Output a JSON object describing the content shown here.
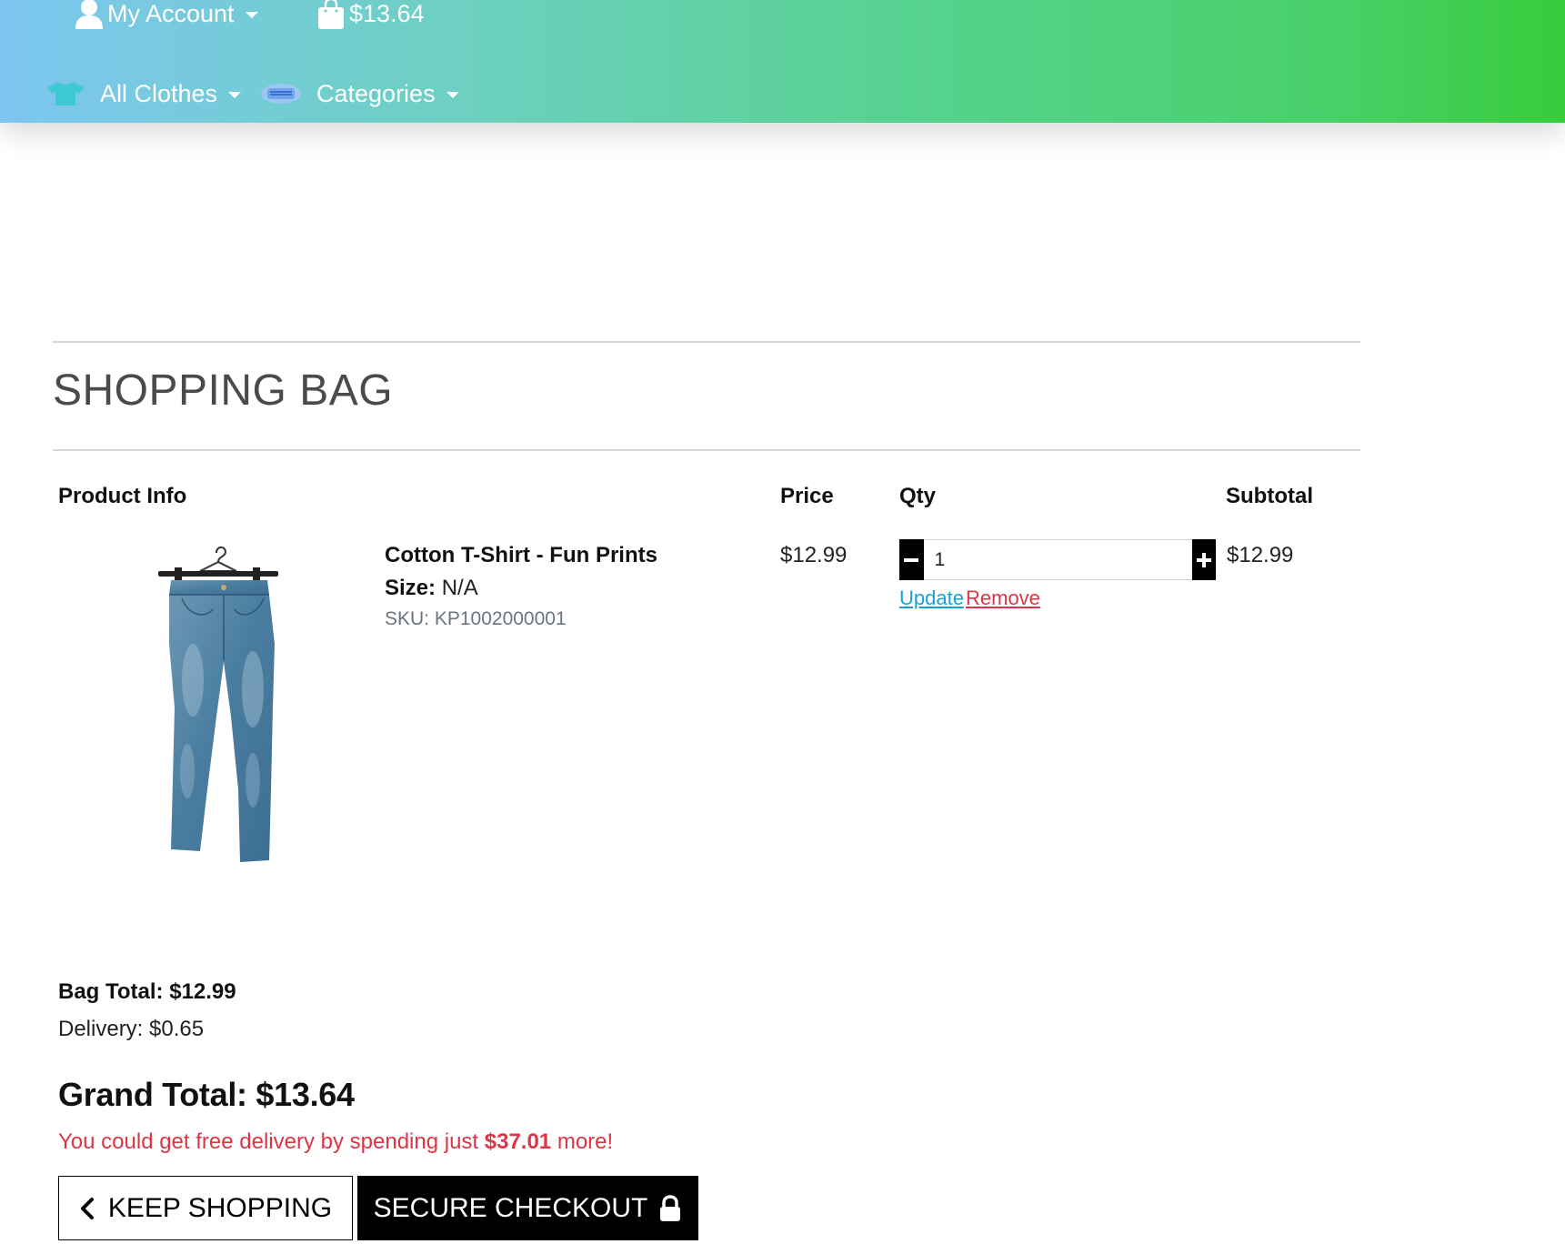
{
  "header": {
    "account_label": "My Account",
    "bag_total": "$13.64",
    "nav": {
      "all_clothes": "All Clothes",
      "categories": "Categories"
    },
    "gradient_colors": [
      "#7dc6f0",
      "#38cc3c"
    ]
  },
  "page": {
    "title": "SHOPPING BAG"
  },
  "table": {
    "headers": {
      "product_info": "Product Info",
      "price": "Price",
      "qty": "Qty",
      "subtotal": "Subtotal"
    },
    "items": [
      {
        "name": "Cotton T-Shirt - Fun Prints",
        "size_label": "Size:",
        "size_value": "N/A",
        "sku": "SKU: KP1002000001",
        "price": "$12.99",
        "qty": "1",
        "subtotal": "$12.99",
        "update_label": "Update",
        "remove_label": "Remove",
        "image": "blue-jeans-on-hanger"
      }
    ]
  },
  "summary": {
    "bag_total": "Bag Total: $12.99",
    "delivery": "Delivery: $0.65",
    "grand_total": "Grand Total: $13.64",
    "free_delivery_prefix": "You could get free delivery by spending just ",
    "free_delivery_amount": "$37.01",
    "free_delivery_suffix": " more!"
  },
  "buttons": {
    "keep_shopping": "KEEP SHOPPING",
    "secure_checkout": "SECURE CHECKOUT"
  },
  "colors": {
    "link_update": "#17a2d8",
    "link_remove": "#dc3545",
    "alert_text": "#dc3545"
  },
  "icons": {
    "account": "user-icon",
    "bag": "shopping-bag-icon",
    "all_clothes": "tshirt-icon",
    "categories": "mask-icon",
    "minus": "minus-icon",
    "plus": "plus-icon",
    "keep_shopping": "chevron-left-icon",
    "checkout": "lock-icon"
  }
}
